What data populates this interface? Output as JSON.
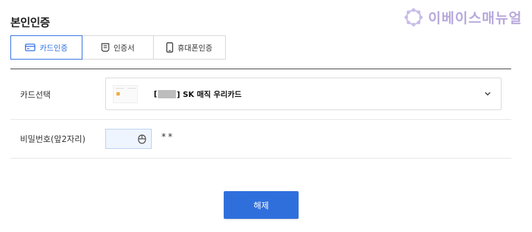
{
  "header": {
    "title": "본인인증"
  },
  "watermark": {
    "text": "이베이스매뉴얼",
    "icon": "flower-logo-icon",
    "color": "#b8a8dc"
  },
  "tabs": [
    {
      "label": "카드인증",
      "icon": "card-icon",
      "active": true
    },
    {
      "label": "인증서",
      "icon": "certificate-icon",
      "active": false
    },
    {
      "label": "휴대폰인증",
      "icon": "mobile-phone-icon",
      "active": false
    }
  ],
  "form": {
    "card_select": {
      "label": "카드선택",
      "value_prefix": "[",
      "value_suffix": "] SK 매직 우리카드"
    },
    "password": {
      "label": "비밀번호(앞2자리)",
      "masked_suffix": "**"
    }
  },
  "actions": {
    "submit_label": "해제"
  },
  "colors": {
    "accent": "#2d6de0",
    "button": "#2f6fdc",
    "input_bg": "#eef5ff"
  }
}
